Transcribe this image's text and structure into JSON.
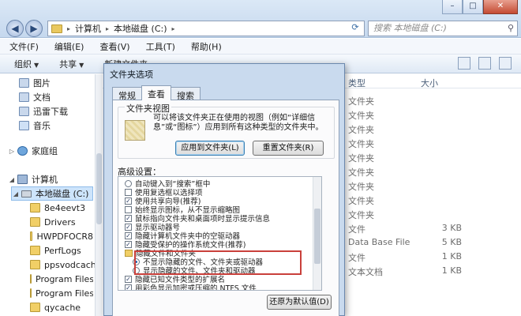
{
  "explorer": {
    "address": {
      "crumbs": [
        "计算机",
        "本地磁盘 (C:)"
      ]
    },
    "search_placeholder": "搜索 本地磁盘 (C:)",
    "menu": [
      "文件(F)",
      "编辑(E)",
      "查看(V)",
      "工具(T)",
      "帮助(H)"
    ],
    "toolbar": {
      "organize": "组织",
      "share": "共享",
      "new_folder": "新建文件夹"
    },
    "window_buttons": {
      "minimize": "–",
      "maximize": "□",
      "close": "✕"
    },
    "sidebar": {
      "libraries": [
        {
          "label": "图片",
          "icon": "pictures-icon"
        },
        {
          "label": "文档",
          "icon": "documents-icon"
        },
        {
          "label": "迅雷下载",
          "icon": "thunder-download-icon"
        },
        {
          "label": "音乐",
          "icon": "music-icon"
        }
      ],
      "homegroup": "家庭组",
      "computer": "计算机",
      "drive": "本地磁盘 (C:)",
      "folders": [
        "8e4eevt3",
        "Drivers",
        "HWPDFOCR8",
        "PerfLogs",
        "ppsvodcache",
        "Program Files",
        "Program Files",
        "qycache"
      ]
    },
    "columns": {
      "type": "类型",
      "size": "大小"
    },
    "rows": [
      {
        "type": "文件夹",
        "size": ""
      },
      {
        "type": "文件夹",
        "size": ""
      },
      {
        "type": "文件夹",
        "size": ""
      },
      {
        "type": "文件夹",
        "size": ""
      },
      {
        "type": "文件夹",
        "size": ""
      },
      {
        "type": "文件夹",
        "size": ""
      },
      {
        "type": "文件夹",
        "size": ""
      },
      {
        "type": "文件夹",
        "size": ""
      },
      {
        "type": "文件夹",
        "size": ""
      },
      {
        "type": "文件",
        "size": "3 KB"
      },
      {
        "type": "Data Base File",
        "size": "5 KB"
      },
      {
        "type": "文件",
        "size": "1 KB"
      },
      {
        "type": "文本文档",
        "size": "1 KB"
      }
    ]
  },
  "dialog": {
    "title": "文件夹选项",
    "tabs": [
      "常规",
      "查看",
      "搜索"
    ],
    "folder_views": {
      "title": "文件夹视图",
      "description": "可以将该文件夹正在使用的视图（例如“详细信息”或“图标”）应用到所有这种类型的文件夹中。",
      "apply_button": "应用到文件夹(L)",
      "reset_button": "重置文件夹(R)"
    },
    "advanced_label": "高级设置：",
    "settings": [
      {
        "kind": "radio",
        "checked": false,
        "label": "自动键入到“搜索”框中"
      },
      {
        "kind": "check",
        "checked": false,
        "label": "使用复选框以选择项"
      },
      {
        "kind": "check",
        "checked": true,
        "label": "使用共享向导(推荐)"
      },
      {
        "kind": "check",
        "checked": false,
        "label": "始终显示图标，从不显示缩略图"
      },
      {
        "kind": "check",
        "checked": true,
        "label": "鼠标指向文件夹和桌面项时显示提示信息"
      },
      {
        "kind": "check",
        "checked": true,
        "label": "显示驱动器号"
      },
      {
        "kind": "check",
        "checked": true,
        "label": "隐藏计算机文件夹中的空驱动器"
      },
      {
        "kind": "check",
        "checked": true,
        "label": "隐藏受保护的操作系统文件(推荐)"
      },
      {
        "kind": "folder",
        "checked": false,
        "label": "隐藏文件和文件夹"
      },
      {
        "kind": "radio",
        "checked": true,
        "label": "不显示隐藏的文件、文件夹或驱动器"
      },
      {
        "kind": "radio",
        "checked": false,
        "label": "显示隐藏的文件、文件夹和驱动器"
      },
      {
        "kind": "check",
        "checked": true,
        "label": "隐藏已知文件类型的扩展名"
      },
      {
        "kind": "check",
        "checked": true,
        "label": "用彩色显示加密或压缩的 NTFS 文件"
      }
    ],
    "restore_button": "还原为默认值(D)"
  }
}
